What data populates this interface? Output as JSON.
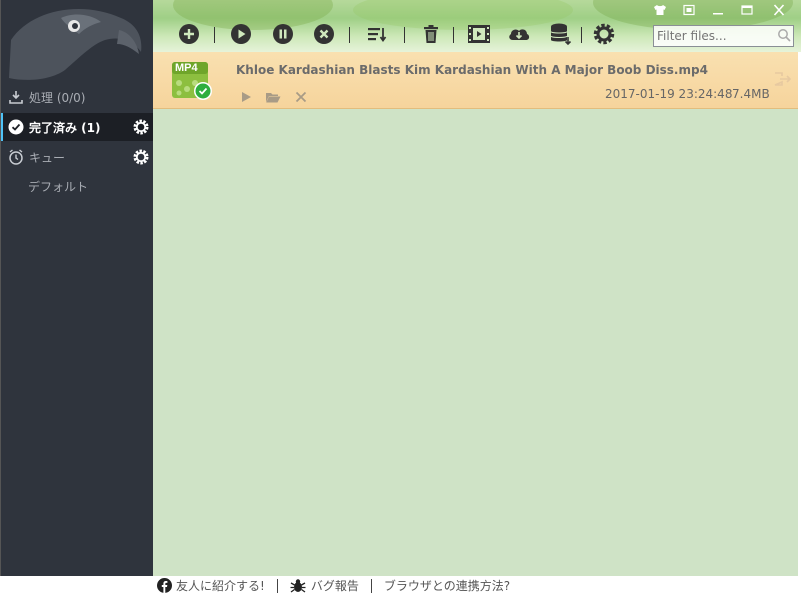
{
  "sidebar": {
    "items": [
      {
        "label": "処理 (0/0)",
        "icon": "download-icon"
      },
      {
        "label": "完了済み (1)",
        "icon": "check-circle-icon"
      },
      {
        "label": "キュー",
        "icon": "alarm-clock-icon"
      }
    ],
    "sub_item": "デフォルト"
  },
  "toolbar": {
    "buttons": [
      "add-icon",
      "play-icon",
      "pause-icon",
      "stop-icon",
      "sort-icon",
      "trash-icon",
      "video-icon",
      "cloud-download-icon",
      "database-icon",
      "settings-icon"
    ],
    "filter_placeholder": "Filter files..."
  },
  "window_controls": [
    "skin-icon",
    "restore-icon",
    "minimize-icon",
    "maximize-icon",
    "close-icon"
  ],
  "downloads": [
    {
      "type_badge": "MP4",
      "name": "Khloe Kardashian Blasts Kim Kardashian With A Major Boob Diss.mp4",
      "date": "2017-01-19 23:24:48",
      "size": "7.4MB",
      "status": "completed"
    }
  ],
  "footer": {
    "share": "友人に紹介する!",
    "bug": "バグ報告",
    "browser": "ブラウザとの連携方法?"
  },
  "colors": {
    "sidebar_bg": "#2f343d",
    "main_bg": "#cfe3c6",
    "row_bg": "#f7d9a4",
    "accent": "#4fc3f7"
  }
}
